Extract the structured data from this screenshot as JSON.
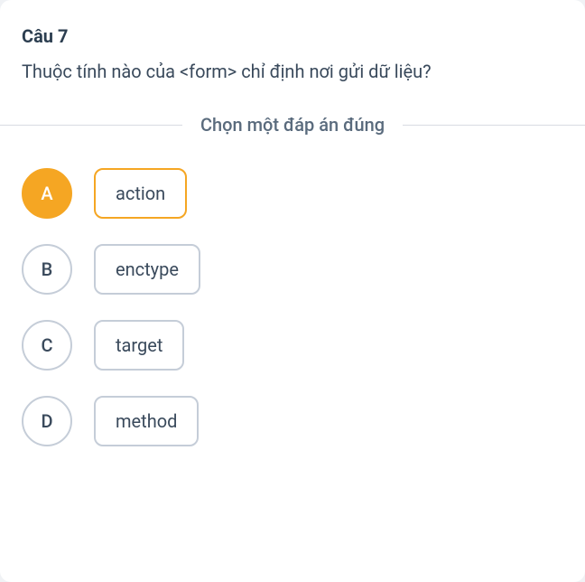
{
  "question": {
    "number_label": "Câu 7",
    "text": "Thuộc tính nào của <form> chỉ định nơi gửi dữ liệu?"
  },
  "instruction": "Chọn một đáp án đúng",
  "options": [
    {
      "letter": "A",
      "label": "action",
      "selected": true
    },
    {
      "letter": "B",
      "label": "enctype",
      "selected": false
    },
    {
      "letter": "C",
      "label": "target",
      "selected": false
    },
    {
      "letter": "D",
      "label": "method",
      "selected": false
    }
  ]
}
